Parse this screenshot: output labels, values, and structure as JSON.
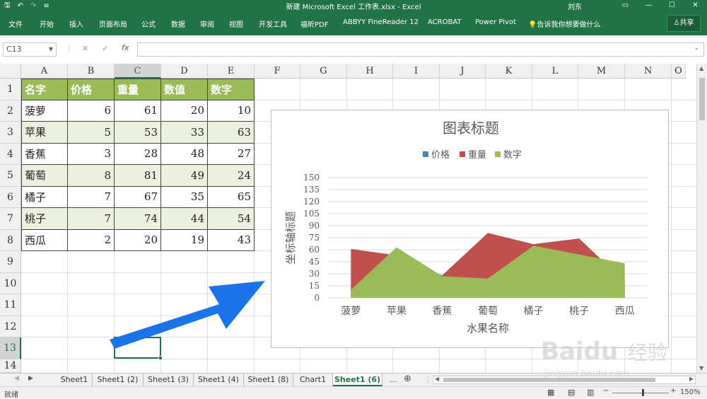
{
  "titlebar": {
    "title": "新建 Microsoft Excel 工作表.xlsx  -  Excel",
    "user": "刘东",
    "save_glyph": "🖫",
    "undo_glyph": "↶",
    "redo_glyph": "↷",
    "customize_glyph": "≡",
    "ribbon_opts_glyph": "▭",
    "min_glyph": "—",
    "max_glyph": "☐",
    "close_glyph": "✕"
  },
  "ribbon": {
    "tabs": [
      "文件",
      "开始",
      "插入",
      "页面布局",
      "公式",
      "数据",
      "审阅",
      "视图",
      "开发工具",
      "福昕PDF",
      "ABBYY FineReader 12",
      "ACROBAT",
      "Power Pivot"
    ],
    "tellme": "告诉我你想要做什么",
    "share": "共享"
  },
  "formula_bar": {
    "name_box": "C13",
    "cancel_glyph": "✕",
    "enter_glyph": "✓",
    "fx_label": "fx",
    "formula": ""
  },
  "columns": [
    "A",
    "B",
    "C",
    "D",
    "E",
    "F",
    "G",
    "H",
    "I",
    "J",
    "K",
    "L",
    "M",
    "N",
    "O"
  ],
  "rows": [
    "1",
    "2",
    "3",
    "4",
    "5",
    "6",
    "7",
    "8",
    "9",
    "10",
    "11",
    "12",
    "13",
    "14"
  ],
  "table": {
    "headers": [
      "名字",
      "价格",
      "重量",
      "数值",
      "数字"
    ],
    "rows": [
      [
        "菠萝",
        "6",
        "61",
        "20",
        "10"
      ],
      [
        "苹果",
        "5",
        "53",
        "33",
        "63"
      ],
      [
        "香蕉",
        "3",
        "28",
        "48",
        "27"
      ],
      [
        "葡萄",
        "8",
        "81",
        "49",
        "24"
      ],
      [
        "橘子",
        "7",
        "67",
        "35",
        "65"
      ],
      [
        "桃子",
        "7",
        "74",
        "44",
        "54"
      ],
      [
        "西瓜",
        "2",
        "20",
        "19",
        "43"
      ]
    ]
  },
  "colors": {
    "excel_green": "#217346",
    "header_fill": "#9bbb59",
    "band_fill": "#ebf1de",
    "series_price": "#4f81bd",
    "series_weight": "#c0504d",
    "series_number": "#9bbb59",
    "arrow": "#1a73e8"
  },
  "chart_data": {
    "type": "area",
    "title": "图表标题",
    "xlabel": "水果名称",
    "ylabel": "坐标轴标题",
    "categories": [
      "菠萝",
      "苹果",
      "香蕉",
      "葡萄",
      "橘子",
      "桃子",
      "西瓜"
    ],
    "series": [
      {
        "name": "价格",
        "values": [
          6,
          5,
          3,
          8,
          7,
          7,
          2
        ]
      },
      {
        "name": "重量",
        "values": [
          61,
          53,
          28,
          81,
          67,
          74,
          20
        ]
      },
      {
        "name": "数字",
        "values": [
          10,
          63,
          27,
          24,
          65,
          54,
          43
        ]
      }
    ],
    "ylim": [
      0,
      150
    ],
    "yticks": [
      0,
      15,
      30,
      45,
      60,
      75,
      90,
      105,
      120,
      135,
      150
    ],
    "grid": true,
    "legend": "top"
  },
  "sheets": {
    "tabs": [
      "Sheet1",
      "Sheet1 (2)",
      "Sheet1 (3)",
      "Sheet1 (4)",
      "Sheet1 (8)",
      "Chart1",
      "Sheet1 (6)"
    ],
    "active": "Sheet1 (6)",
    "more_glyph": "...",
    "add_glyph": "⊕"
  },
  "status": {
    "ready": "就绪",
    "zoom": "150%"
  },
  "watermark": {
    "logo": "Baidu",
    "jingyan": "经验",
    "url": "jingyan.baidu.com"
  }
}
